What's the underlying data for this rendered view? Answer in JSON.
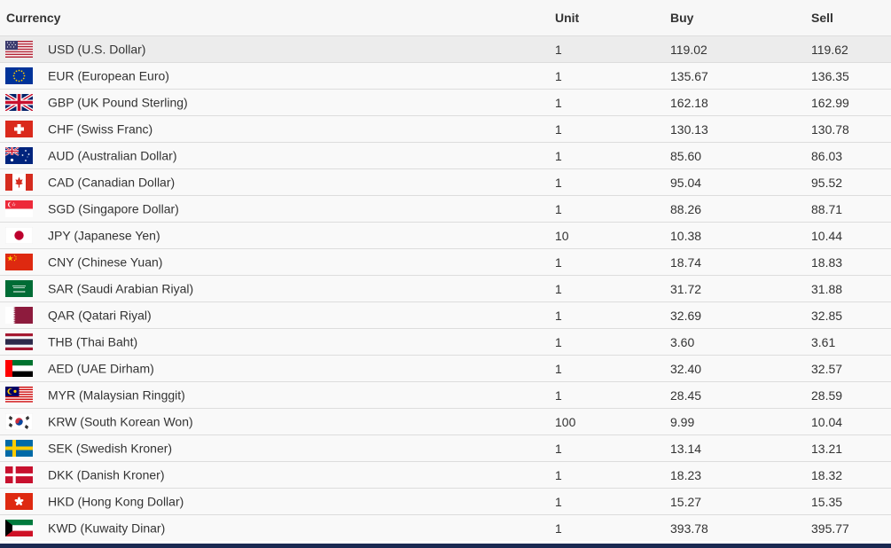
{
  "table": {
    "headers": {
      "currency": "Currency",
      "unit": "Unit",
      "buy": "Buy",
      "sell": "Sell"
    },
    "rows": [
      {
        "code": "USD",
        "name": "USD (U.S. Dollar)",
        "unit": "1",
        "buy": "119.02",
        "sell": "119.62",
        "flag": "us-flag-icon"
      },
      {
        "code": "EUR",
        "name": "EUR (European Euro)",
        "unit": "1",
        "buy": "135.67",
        "sell": "136.35",
        "flag": "eu-flag-icon"
      },
      {
        "code": "GBP",
        "name": "GBP (UK Pound Sterling)",
        "unit": "1",
        "buy": "162.18",
        "sell": "162.99",
        "flag": "uk-flag-icon"
      },
      {
        "code": "CHF",
        "name": "CHF (Swiss Franc)",
        "unit": "1",
        "buy": "130.13",
        "sell": "130.78",
        "flag": "swiss-flag-icon"
      },
      {
        "code": "AUD",
        "name": "AUD (Australian Dollar)",
        "unit": "1",
        "buy": "85.60",
        "sell": "86.03",
        "flag": "australia-flag-icon"
      },
      {
        "code": "CAD",
        "name": "CAD (Canadian Dollar)",
        "unit": "1",
        "buy": "95.04",
        "sell": "95.52",
        "flag": "canada-flag-icon"
      },
      {
        "code": "SGD",
        "name": "SGD (Singapore Dollar)",
        "unit": "1",
        "buy": "88.26",
        "sell": "88.71",
        "flag": "singapore-flag-icon"
      },
      {
        "code": "JPY",
        "name": "JPY (Japanese Yen)",
        "unit": "10",
        "buy": "10.38",
        "sell": "10.44",
        "flag": "japan-flag-icon"
      },
      {
        "code": "CNY",
        "name": "CNY (Chinese Yuan)",
        "unit": "1",
        "buy": "18.74",
        "sell": "18.83",
        "flag": "china-flag-icon"
      },
      {
        "code": "SAR",
        "name": "SAR (Saudi Arabian Riyal)",
        "unit": "1",
        "buy": "31.72",
        "sell": "31.88",
        "flag": "saudi-flag-icon"
      },
      {
        "code": "QAR",
        "name": "QAR (Qatari Riyal)",
        "unit": "1",
        "buy": "32.69",
        "sell": "32.85",
        "flag": "qatar-flag-icon"
      },
      {
        "code": "THB",
        "name": "THB (Thai Baht)",
        "unit": "1",
        "buy": "3.60",
        "sell": "3.61",
        "flag": "thailand-flag-icon"
      },
      {
        "code": "AED",
        "name": "AED (UAE Dirham)",
        "unit": "1",
        "buy": "32.40",
        "sell": "32.57",
        "flag": "uae-flag-icon"
      },
      {
        "code": "MYR",
        "name": "MYR (Malaysian Ringgit)",
        "unit": "1",
        "buy": "28.45",
        "sell": "28.59",
        "flag": "malaysia-flag-icon"
      },
      {
        "code": "KRW",
        "name": "KRW (South Korean Won)",
        "unit": "100",
        "buy": "9.99",
        "sell": "10.04",
        "flag": "korea-flag-icon"
      },
      {
        "code": "SEK",
        "name": "SEK (Swedish Kroner)",
        "unit": "1",
        "buy": "13.14",
        "sell": "13.21",
        "flag": "sweden-flag-icon"
      },
      {
        "code": "DKK",
        "name": "DKK (Danish Kroner)",
        "unit": "1",
        "buy": "18.23",
        "sell": "18.32",
        "flag": "denmark-flag-icon"
      },
      {
        "code": "HKD",
        "name": "HKD (Hong Kong Dollar)",
        "unit": "1",
        "buy": "15.27",
        "sell": "15.35",
        "flag": "hongkong-flag-icon"
      },
      {
        "code": "KWD",
        "name": "KWD (Kuwaity Dinar)",
        "unit": "1",
        "buy": "393.78",
        "sell": "395.77",
        "flag": "kuwait-flag-icon"
      }
    ]
  },
  "colors": {
    "header_bg": "#f7f7f7",
    "row_bg": "#f9f9f9",
    "active_row_bg": "#ececec",
    "border": "#dddddd",
    "text": "#333333",
    "bottom_bar": "#1b2a52"
  }
}
